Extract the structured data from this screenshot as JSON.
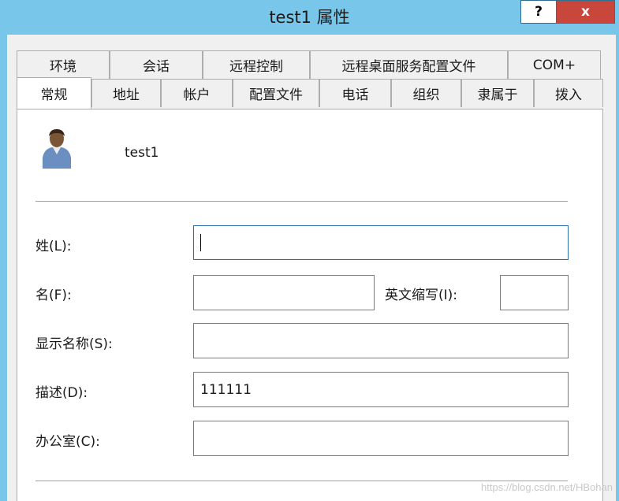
{
  "window": {
    "title": "test1 属性",
    "help_label": "?",
    "close_label": "x"
  },
  "tabs": {
    "row1": [
      "环境",
      "会话",
      "远程控制",
      "远程桌面服务配置文件",
      "COM+"
    ],
    "row2": [
      "常规",
      "地址",
      "帐户",
      "配置文件",
      "电话",
      "组织",
      "隶属于",
      "拨入"
    ],
    "active": "常规"
  },
  "general": {
    "display_name": "test1",
    "avatar_icon": "user-icon",
    "labels": {
      "last_name": "姓(L):",
      "first_name": "名(F):",
      "initials": "英文缩写(I):",
      "display_name": "显示名称(S):",
      "description": "描述(D):",
      "office": "办公室(C):"
    },
    "values": {
      "last_name": "",
      "first_name": "",
      "initials": "",
      "display_name": "",
      "description": "111111",
      "office": ""
    }
  },
  "watermark": "https://blog.csdn.net/HBohan"
}
